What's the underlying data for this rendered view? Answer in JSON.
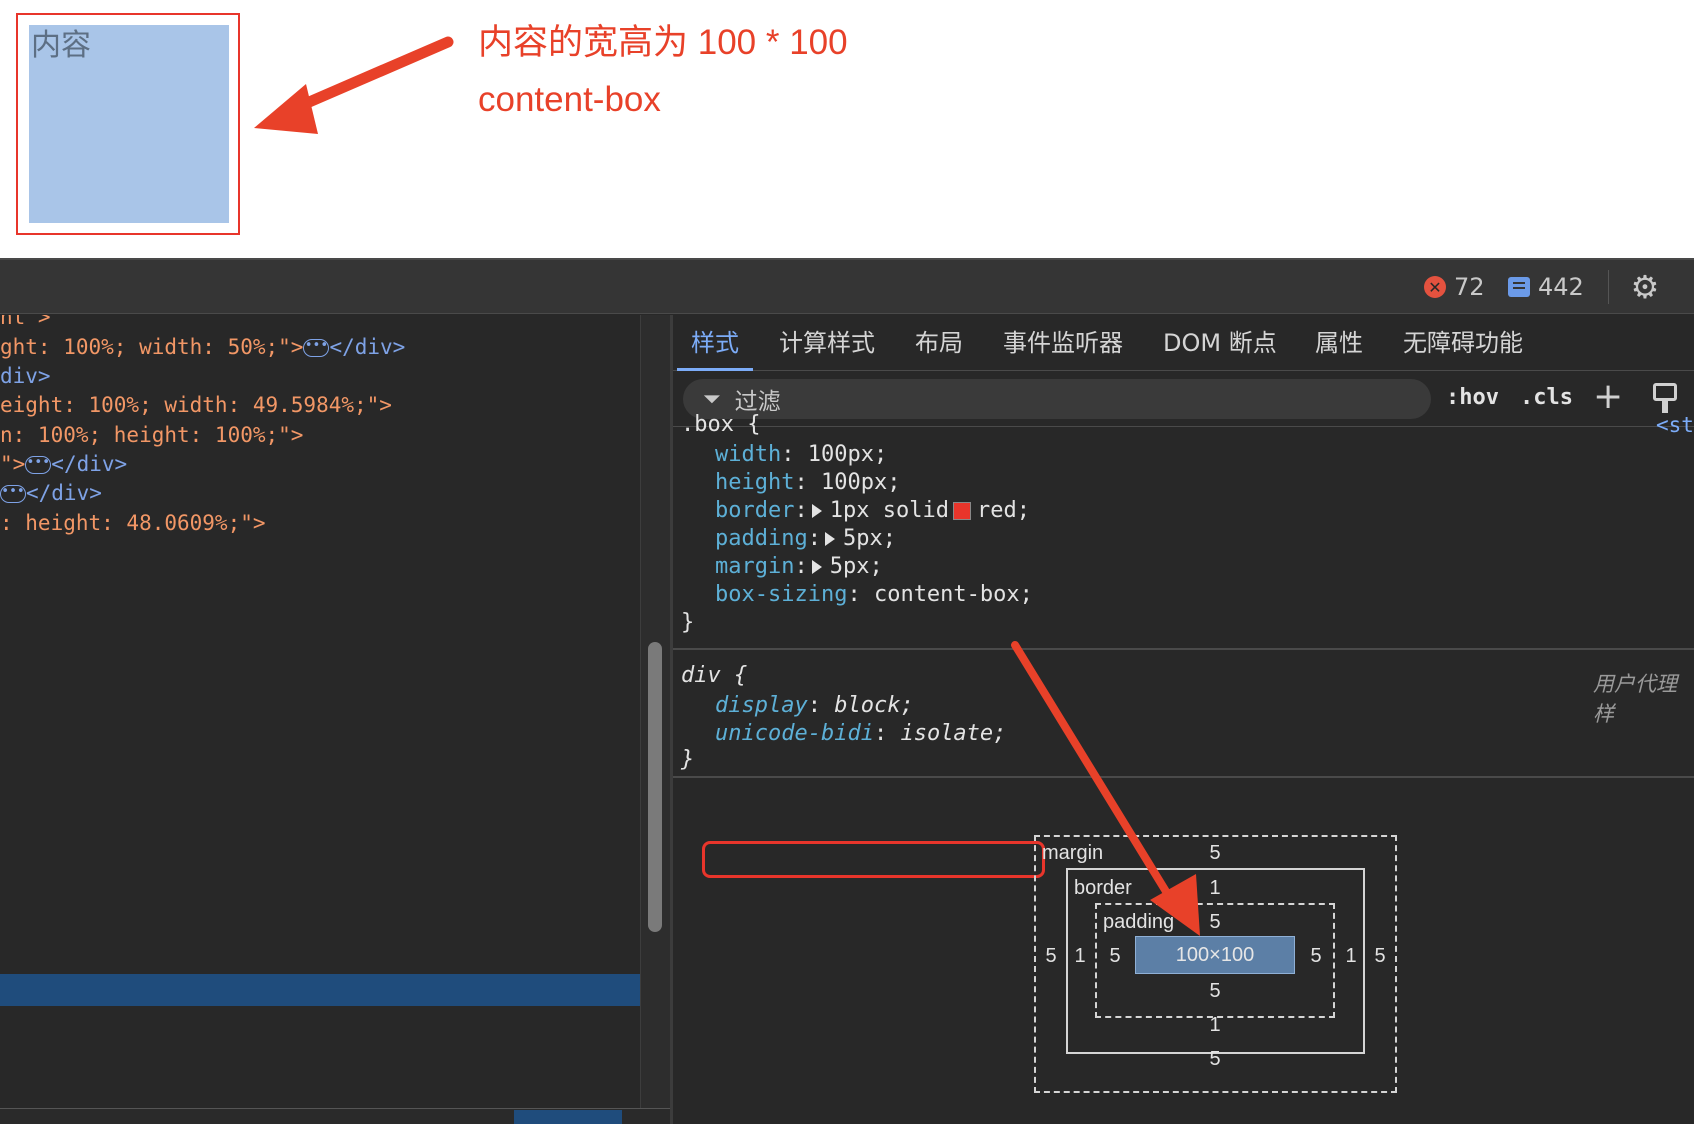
{
  "demo": {
    "box_text": "内容",
    "annotation_line1": "内容的宽高为 100 * 100",
    "annotation_line2": "content-box"
  },
  "toolbar": {
    "error_count": "72",
    "message_count": "442",
    "error_icon": "error-x-icon",
    "message_icon": "message-icon",
    "settings_icon": "gear-icon"
  },
  "elements": {
    "lines": [
      {
        "attr": "nt\">",
        "rest": ""
      },
      {
        "attr": "ght: 100%; width: 50%;\">",
        "rest": "</div>",
        "dots": true
      },
      {
        "attr": "",
        "rest": "div>"
      },
      {
        "attr": "eight: 100%; width: 49.5984%;\">",
        "rest": ""
      },
      {
        "attr": "n: 100%; height: 100%;\">",
        "rest": ""
      },
      {
        "attr": "\">",
        "rest": "</div>",
        "dots": true
      },
      {
        "attr": "",
        "rest": "</div>",
        "dots": true
      },
      {
        "attr": ": height: 48.0609%;\">",
        "rest": ""
      }
    ]
  },
  "styles": {
    "tabs": [
      "样式",
      "计算样式",
      "布局",
      "事件监听器",
      "DOM 断点",
      "属性",
      "无障碍功能"
    ],
    "filter_placeholder": "过滤",
    "hov_label": ":hov",
    "cls_label": ".cls",
    "rule1": {
      "selector": ".box {",
      "source": "<st",
      "props": [
        {
          "name": "width",
          "value": "100px;"
        },
        {
          "name": "height",
          "value": "100px;"
        },
        {
          "name": "border",
          "value": "1px solid",
          "swatch": "#e8352b",
          "value2": "red;"
        },
        {
          "name": "padding",
          "value": "5px;"
        },
        {
          "name": "margin",
          "value": "5px;"
        },
        {
          "name": "box-sizing",
          "value": "content-box;"
        }
      ],
      "close": "}"
    },
    "rule2": {
      "selector": "div {",
      "source": "用户代理样",
      "props": [
        {
          "name": "display",
          "value": "block;"
        },
        {
          "name": "unicode-bidi",
          "value": "isolate;"
        }
      ],
      "close": "}"
    }
  },
  "box_model": {
    "margin_label": "margin",
    "border_label": "border",
    "padding_label": "padding",
    "content": "100×100",
    "margin": {
      "top": "5",
      "right": "5",
      "bottom": "5",
      "left": "5"
    },
    "border": {
      "top": "1",
      "right": "1",
      "bottom": "1",
      "left": "1"
    },
    "padding": {
      "top": "5",
      "right": "5",
      "bottom": "5",
      "left": "5"
    }
  },
  "colors": {
    "annotation": "#e84129",
    "accent": "#7cacf8",
    "selection": "#1f4c7c",
    "content_fill": "#a9c5e8"
  }
}
